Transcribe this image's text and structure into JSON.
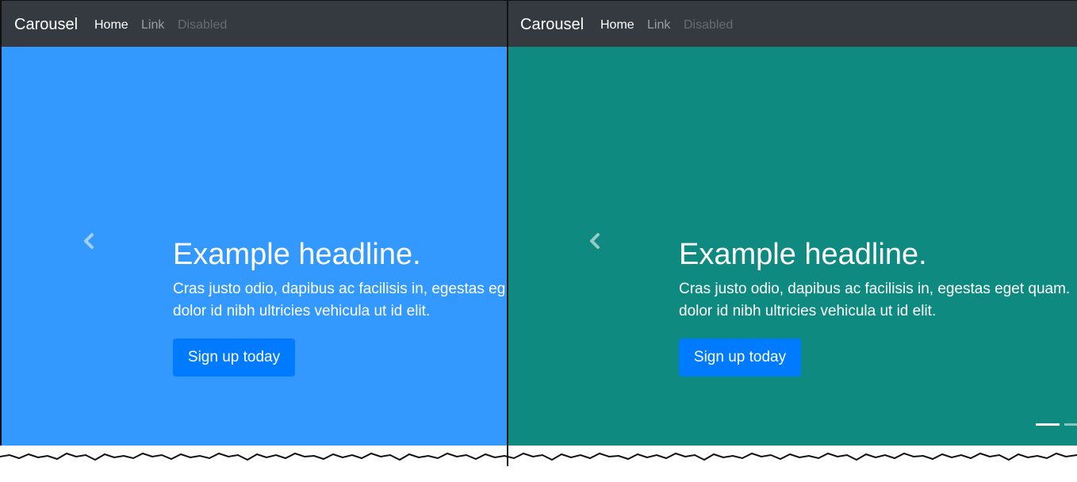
{
  "colors": {
    "navbar": "#343a40",
    "slide_left": "#3399ff",
    "slide_right": "#0e8a80",
    "button": "#007bff",
    "text": "#ffffff"
  },
  "panels": [
    {
      "brand": "Carousel",
      "nav": {
        "home": "Home",
        "link": "Link",
        "disabled": "Disabled"
      },
      "slide": {
        "headline": "Example headline.",
        "lead": "Cras justo odio, dapibus ac facilisis in, egestas eget quam. Donec id elit non mi porta gravida at eget metus. Nullam id dolor id nibh ultricies vehicula ut id elit.",
        "lead_visible": "Cras justo odio, dapibus ac facilisis in, egestas eg",
        "lead_line2": "dolor id nibh ultricies vehicula ut id elit.",
        "button": "Sign up today"
      },
      "icons": {
        "prev": "chevron-left-icon"
      }
    },
    {
      "brand": "Carousel",
      "nav": {
        "home": "Home",
        "link": "Link",
        "disabled": "Disabled"
      },
      "slide": {
        "headline": "Example headline.",
        "lead_visible": "Cras justo odio, dapibus ac facilisis in, egestas eget quam.",
        "lead_line2": "dolor id nibh ultricies vehicula ut id elit.",
        "button": "Sign up today"
      },
      "icons": {
        "prev": "chevron-left-icon"
      }
    }
  ]
}
